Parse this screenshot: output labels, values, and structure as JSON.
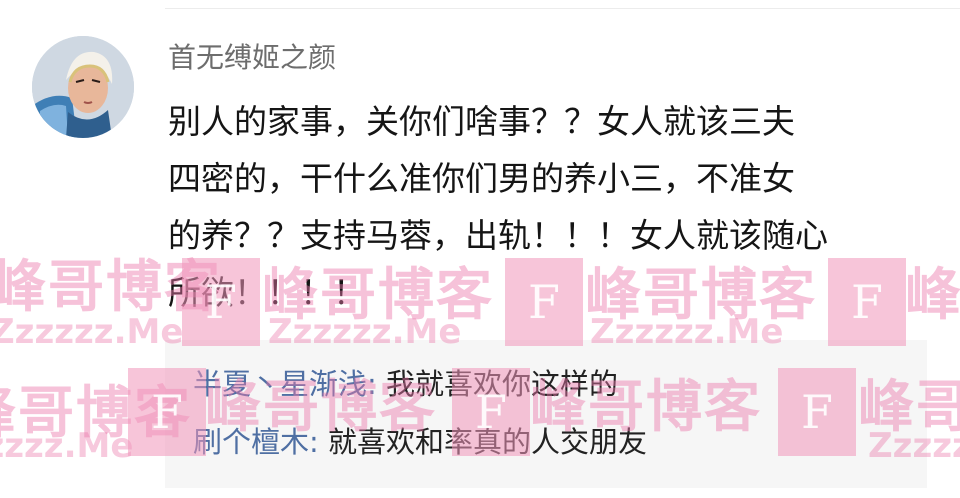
{
  "comment": {
    "username": "首无缚姬之颜",
    "avatar_icon": "anime-character-avatar",
    "text_lines": [
      "别人的家事，关你们啥事？？女人就该三夫",
      "四密的，干什么准你们男的养小三，不准女",
      "的养？？支持马蓉，出轨！！！女人就该随心",
      "所欲！！！！"
    ]
  },
  "replies": [
    {
      "user": "半夏丶星渐浅",
      "separator": ": ",
      "text": "我就喜欢你这样的"
    },
    {
      "user": "刷个檀木",
      "separator": ": ",
      "text": "就喜欢和率真的人交朋友"
    }
  ],
  "watermark": {
    "logo_letter": "F",
    "brand_cn": "峰哥博客",
    "brand_en": "Zzzzzz.Me"
  },
  "colors": {
    "username": "#6d6d6d",
    "reply_user": "#4f6fa3",
    "reply_background": "#f6f6f6",
    "watermark_pink": "#f096b9"
  }
}
